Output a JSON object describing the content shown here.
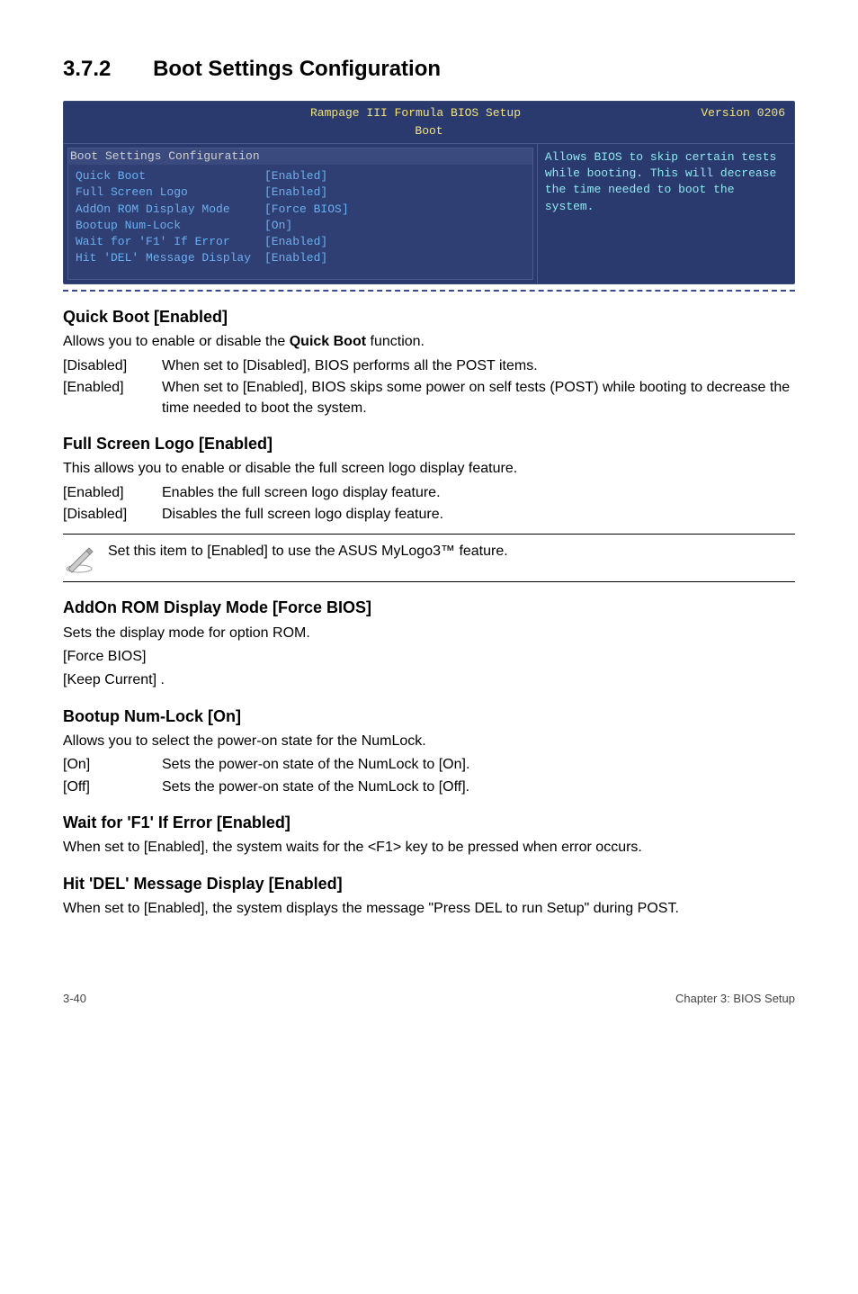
{
  "section": {
    "number": "3.7.2",
    "title": "Boot Settings Configuration"
  },
  "bios": {
    "header_center": "Rampage III Formula BIOS Setup",
    "header_right": "Version 0206",
    "subtitle": "Boot",
    "conf_title": "Boot Settings Configuration",
    "rows": [
      {
        "k": "Quick Boot",
        "v": "[Enabled]"
      },
      {
        "k": "Full Screen Logo",
        "v": "[Enabled]"
      },
      {
        "k": "AddOn ROM Display Mode",
        "v": "[Force BIOS]"
      },
      {
        "k": "Bootup Num-Lock",
        "v": "[On]"
      },
      {
        "k": "Wait for 'F1' If Error",
        "v": "[Enabled]"
      },
      {
        "k": "Hit 'DEL' Message Display",
        "v": "[Enabled]"
      }
    ],
    "help": "Allows BIOS to skip certain tests while booting. This will decrease the time needed to boot the system."
  },
  "quickboot": {
    "h": "Quick Boot [Enabled]",
    "p": "Allows you to enable or disable the Quick Boot function.",
    "p_pre": "Allows you to enable or disable the ",
    "p_bold": "Quick Boot",
    "p_post": " function.",
    "opts": [
      {
        "k": "[Disabled]",
        "v": "When set to [Disabled], BIOS performs all the POST items."
      },
      {
        "k": "[Enabled]",
        "v": "When set to [Enabled], BIOS skips some power on self tests (POST) while booting to decrease the time needed to boot the system."
      }
    ]
  },
  "fullscreen": {
    "h": "Full Screen Logo [Enabled]",
    "p": "This allows you to enable or disable the full screen logo display feature.",
    "opts": [
      {
        "k": "[Enabled]",
        "v": "Enables the full screen logo display feature."
      },
      {
        "k": "[Disabled]",
        "v": "Disables the full screen logo display feature."
      }
    ]
  },
  "note": "Set this item to [Enabled] to use the ASUS MyLogo3™ feature.",
  "addon": {
    "h": "AddOn ROM Display Mode [Force BIOS]",
    "p": "Sets the display mode for option ROM.",
    "l1": "[Force BIOS]",
    "l2": "[Keep Current]  ."
  },
  "numlock": {
    "h": "Bootup Num-Lock [On]",
    "p": "Allows you to select the power-on state for the NumLock.",
    "opts": [
      {
        "k": "[On]",
        "v": "Sets the power-on state of the NumLock to [On]."
      },
      {
        "k": "[Off]",
        "v": "Sets the power-on state of the NumLock to [Off]."
      }
    ]
  },
  "waitf1": {
    "h": "Wait for 'F1' If Error [Enabled]",
    "p": "When set to [Enabled], the system waits for the <F1> key to be pressed when error occurs."
  },
  "hitdel": {
    "h": "Hit 'DEL' Message Display [Enabled]",
    "p": "When set to [Enabled], the system displays the message \"Press DEL to run Setup\" during POST."
  },
  "footer": {
    "left": "3-40",
    "right": "Chapter 3: BIOS Setup"
  }
}
